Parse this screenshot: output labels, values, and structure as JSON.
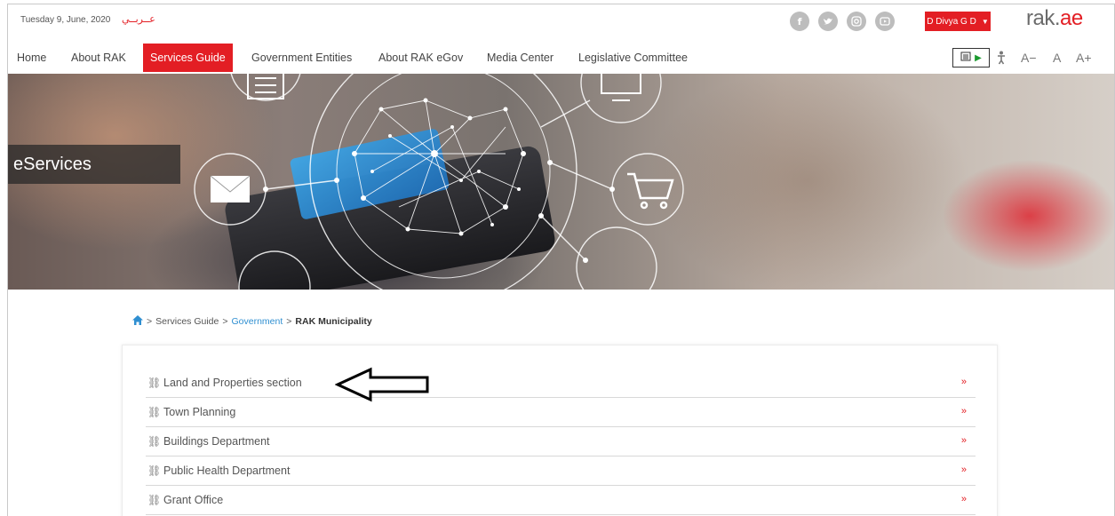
{
  "topbar": {
    "date": "Tuesday 9, June, 2020",
    "arabic_link": "عــربــي",
    "social_icons": [
      "facebook-icon",
      "twitter-icon",
      "instagram-icon",
      "youtube-icon"
    ],
    "user_label": "D Divya G D",
    "logo_main": "rak.",
    "logo_ae": "ae"
  },
  "nav": {
    "items": [
      "Home",
      "About RAK",
      "Services Guide",
      "Government Entities",
      "About RAK eGov",
      "Media Center",
      "Legislative Committee"
    ],
    "active": "Services Guide",
    "font_small": "A−",
    "font_normal": "A",
    "font_large": "A+"
  },
  "hero": {
    "title": "eServices"
  },
  "breadcrumb": {
    "home_icon": "home-icon",
    "sep": ">",
    "services_guide": "Services Guide",
    "government": "Government",
    "current": "RAK Municipality"
  },
  "services": [
    {
      "label": "Land and Properties section"
    },
    {
      "label": "Town Planning"
    },
    {
      "label": "Buildings Department"
    },
    {
      "label": "Public Health Department"
    },
    {
      "label": "Grant Office"
    }
  ],
  "colors": {
    "brand_red": "#e31e24",
    "link_blue": "#2f8fd1"
  }
}
